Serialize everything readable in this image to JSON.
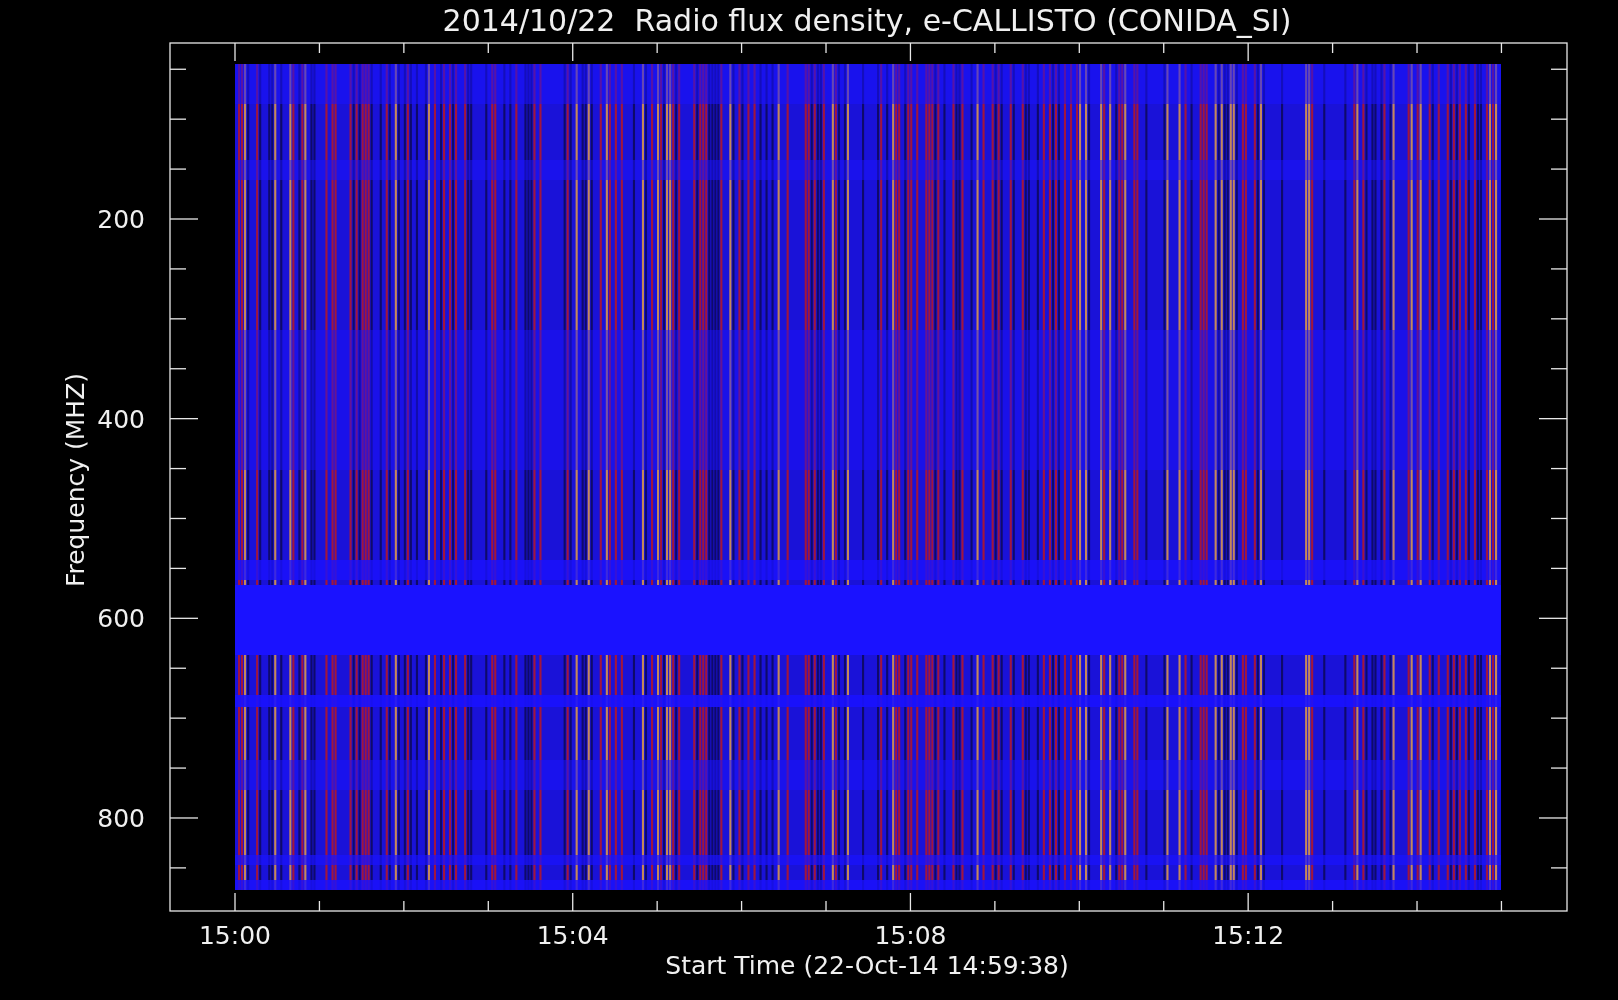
{
  "chart": {
    "title": "2014/10/22  Radio flux density, e-CALLISTO (CONIDA_SI)",
    "xlabel": "Start Time (22-Oct-14 14:59:38)",
    "ylabel": "Frequency (MHZ)",
    "xticks": [
      "15:00",
      "15:04",
      "15:08",
      "15:12"
    ],
    "yticks": [
      "200",
      "400",
      "600",
      "800"
    ]
  }
}
